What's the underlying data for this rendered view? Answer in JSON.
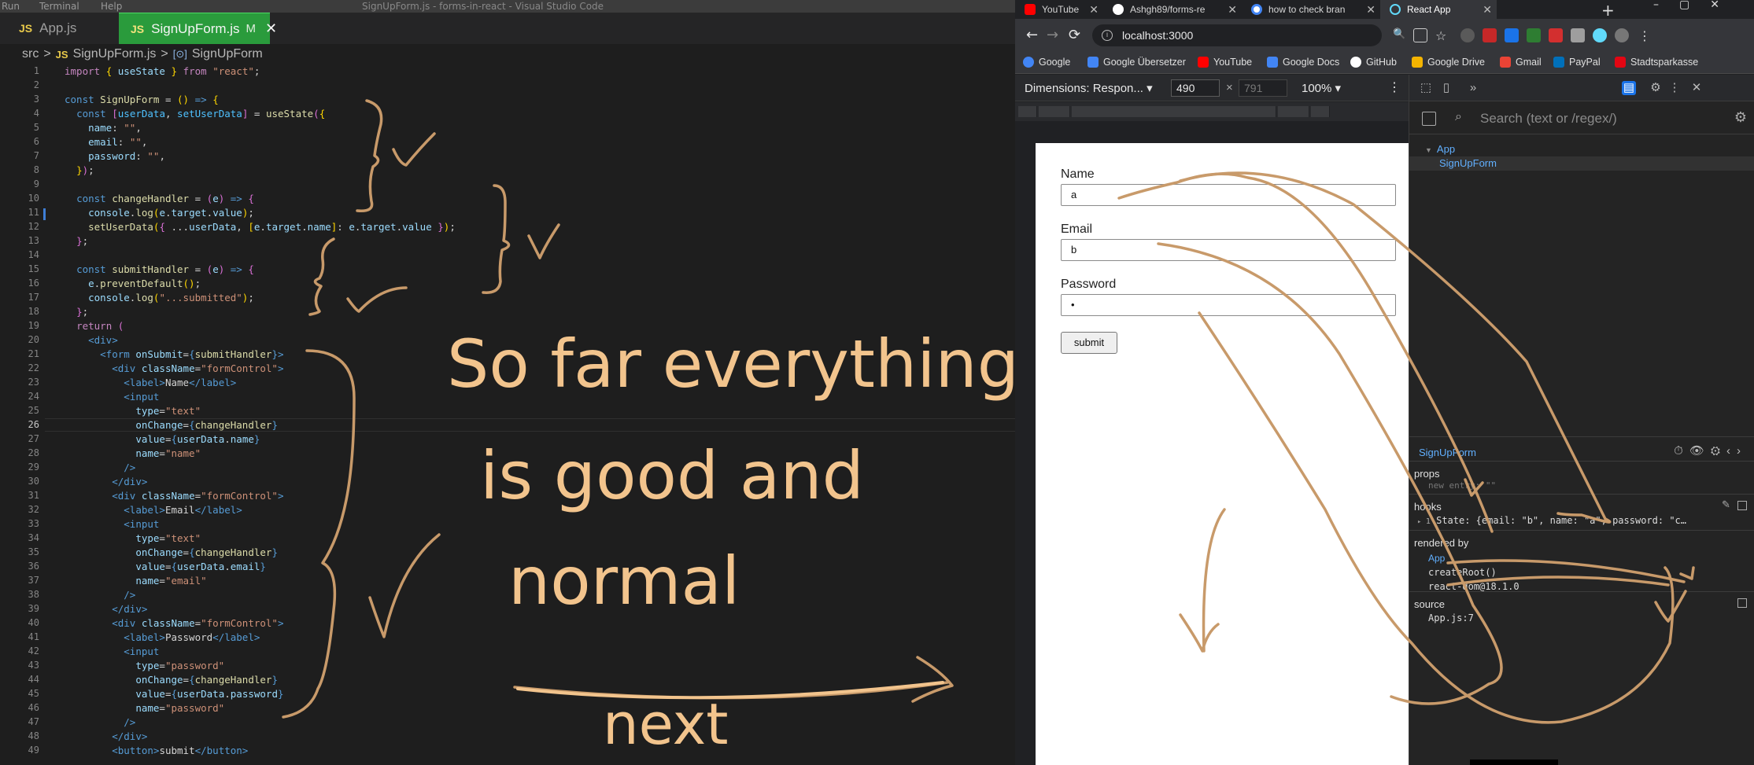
{
  "vscode": {
    "menu": [
      "Run",
      "Terminal",
      "Help"
    ],
    "window_title": "SignUpForm.js - forms-in-react - Visual Studio Code",
    "tabs": [
      {
        "icon": "JS",
        "label": "App.js"
      },
      {
        "icon": "JS",
        "label": "SignUpForm.js",
        "modified": "M",
        "close": "✕"
      }
    ],
    "breadcrumb": {
      "folder": "src",
      "sep": ">",
      "file_icon": "JS",
      "file": "SignUpForm.js",
      "symbol": "SignUpForm"
    },
    "line_numbers": [
      "1",
      "2",
      "3",
      "4",
      "5",
      "6",
      "7",
      "8",
      "9",
      "10",
      "11",
      "12",
      "13",
      "14",
      "15",
      "16",
      "17",
      "18",
      "19",
      "20",
      "21",
      "22",
      "23",
      "24",
      "25",
      "26",
      "27",
      "28",
      "29",
      "30",
      "31",
      "32",
      "33",
      "34",
      "35",
      "36",
      "37",
      "38",
      "39",
      "40",
      "41",
      "42",
      "43",
      "44",
      "45",
      "46",
      "47",
      "48",
      "49"
    ]
  },
  "annotations": {
    "line1": "So far everything",
    "line2": "is good and",
    "line3": "normal",
    "next": "next"
  },
  "chrome": {
    "tabs": [
      {
        "label": "YouTube",
        "icon": "youtube-icon",
        "color": "#ff0000"
      },
      {
        "label": "Ashgh89/forms-re",
        "icon": "github-icon",
        "color": "#ffffff"
      },
      {
        "label": "how to check bran",
        "icon": "google-icon",
        "color": "#4285f4"
      },
      {
        "label": "React App",
        "icon": "react-icon",
        "color": "#61dafb"
      }
    ],
    "url": "localhost:3000",
    "bookmarks": [
      {
        "label": "Google",
        "color": "#4285f4"
      },
      {
        "label": "Google Übersetzer",
        "color": "#4285f4"
      },
      {
        "label": "YouTube",
        "color": "#ff0000"
      },
      {
        "label": "Google Docs",
        "color": "#4285f4"
      },
      {
        "label": "GitHub",
        "color": "#ffffff"
      },
      {
        "label": "Google Drive",
        "color": "#f4b400"
      },
      {
        "label": "Gmail",
        "color": "#ea4335"
      },
      {
        "label": "PayPal",
        "color": "#0070ba"
      },
      {
        "label": "Stadtsparkasse",
        "color": "#e30613"
      }
    ]
  },
  "device_toolbar": {
    "dimensions": "Dimensions: Respon...",
    "width": "490",
    "times": "×",
    "height": "791",
    "zoom": "100%"
  },
  "form": {
    "name_label": "Name",
    "name_value": "a",
    "email_label": "Email",
    "email_value": "b",
    "password_label": "Password",
    "password_value": "•",
    "submit": "submit"
  },
  "devtools": {
    "search_placeholder": "Search (text or /regex/)",
    "tree": [
      "App",
      "SignUpForm"
    ],
    "selected": "SignUpForm",
    "props_header": "props",
    "props_new_entry": "new entry: \"\"",
    "hooks_header": "hooks",
    "hook_index": "1",
    "hook_state": "State: {email: \"b\", name: \"a\", password: \"c…",
    "rendered_by_header": "rendered by",
    "rendered_by": [
      "App",
      "createRoot()",
      "react-dom@18.1.0"
    ],
    "source_header": "source",
    "source": "App.js:7"
  }
}
